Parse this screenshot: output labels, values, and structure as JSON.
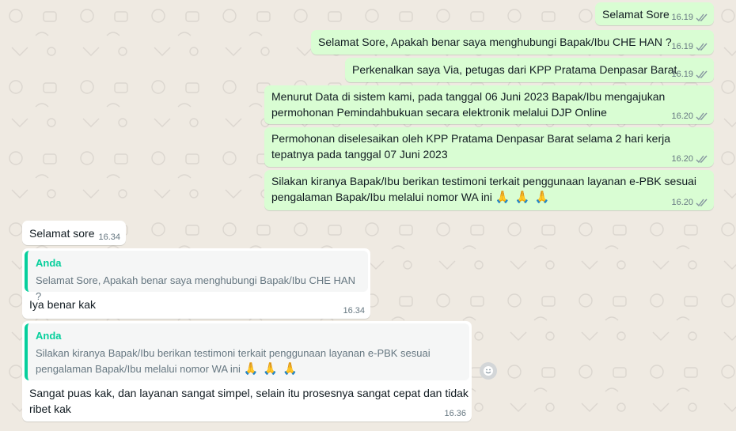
{
  "outgoing": [
    {
      "text": "Selamat Sore",
      "time": "16.19"
    },
    {
      "text": "Selamat Sore, Apakah benar saya menghubungi Bapak/Ibu CHE HAN ?",
      "time": "16.19"
    },
    {
      "text": "Perkenalkan saya Via, petugas dari KPP Pratama Denpasar Barat",
      "time": "16.19"
    },
    {
      "text": "Menurut Data di sistem kami, pada tanggal 06 Juni 2023 Bapak/Ibu mengajukan permohonan Pemindahbukuan secara elektronik melalui DJP Online",
      "time": "16.20"
    },
    {
      "text": "Permohonan diselesaikan oleh KPP Pratama Denpasar Barat selama 2 hari kerja tepatnya pada tanggal 07 Juni 2023",
      "time": "16.20"
    },
    {
      "text": "Silakan kiranya Bapak/Ibu berikan testimoni terkait penggunaan layanan e-PBK sesuai pengalaman Bapak/Ibu melalui nomor WA ini",
      "emoji": "🙏 🙏 🙏",
      "time": "16.20"
    }
  ],
  "incoming": [
    {
      "text": "Selamat sore",
      "time": "16.34"
    },
    {
      "quote_author": "Anda",
      "quote_text": "Selamat Sore, Apakah benar saya menghubungi Bapak/Ibu CHE HAN ?",
      "text": "Iya benar kak",
      "time": "16.34"
    },
    {
      "quote_author": "Anda",
      "quote_text": "Silakan kiranya Bapak/Ibu berikan testimoni terkait penggunaan layanan e-PBK sesuai pengalaman Bapak/Ibu melalui nomor WA ini",
      "quote_emoji": "🙏 🙏 🙏",
      "text": "Sangat puas kak, dan layanan sangat simpel, selain itu prosesnya sangat cepat dan tidak ribet kak",
      "time": "16.36"
    }
  ],
  "icons": {
    "read_receipt": "double-check-icon",
    "reaction": "smiley-icon"
  },
  "colors": {
    "outgoing_bubble": "#d9fdd3",
    "incoming_bubble": "#ffffff",
    "quote_accent": "#06cf9c",
    "tick": "#8696a0",
    "background": "#efeae2"
  }
}
